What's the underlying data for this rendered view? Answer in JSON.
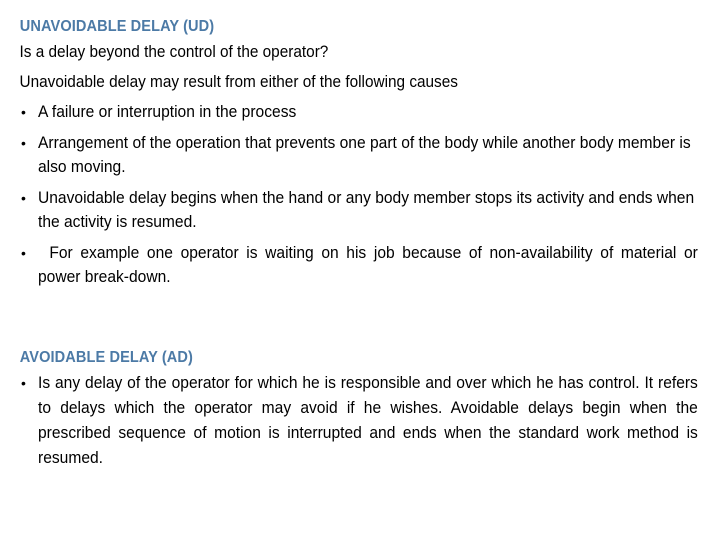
{
  "document": {
    "background_color": "#ffffff",
    "heading_color": "#4c7aa6",
    "body_color": "#000000",
    "bullet_glyph": "•"
  },
  "sections": [
    {
      "id": "unavoidable-delay",
      "heading": "UNAVOIDABLE DELAY (UD)",
      "paragraphs": [
        "Is a delay beyond the control of the operator?",
        "Unavoidable delay may result from either of the following causes"
      ],
      "bullets": [
        "A failure or interruption in the process",
        "Arrangement of the operation that prevents one part of the body while another body member is also moving.",
        "Unavoidable delay begins when the hand or any body member stops its activity and ends when the activity is resumed.",
        "For example one operator is waiting on his job because of non-availability of material or power break-down."
      ]
    },
    {
      "id": "avoidable-delay",
      "heading": "AVOIDABLE DELAY (AD)",
      "paragraphs": [],
      "bullets": [
        "Is any delay of the operator for which he is responsible and over which he has control. It refers to delays which the operator may avoid if he wishes. Avoidable delays begin when the prescribed sequence of motion is interrupted and ends when the standard work method is resumed."
      ]
    }
  ]
}
